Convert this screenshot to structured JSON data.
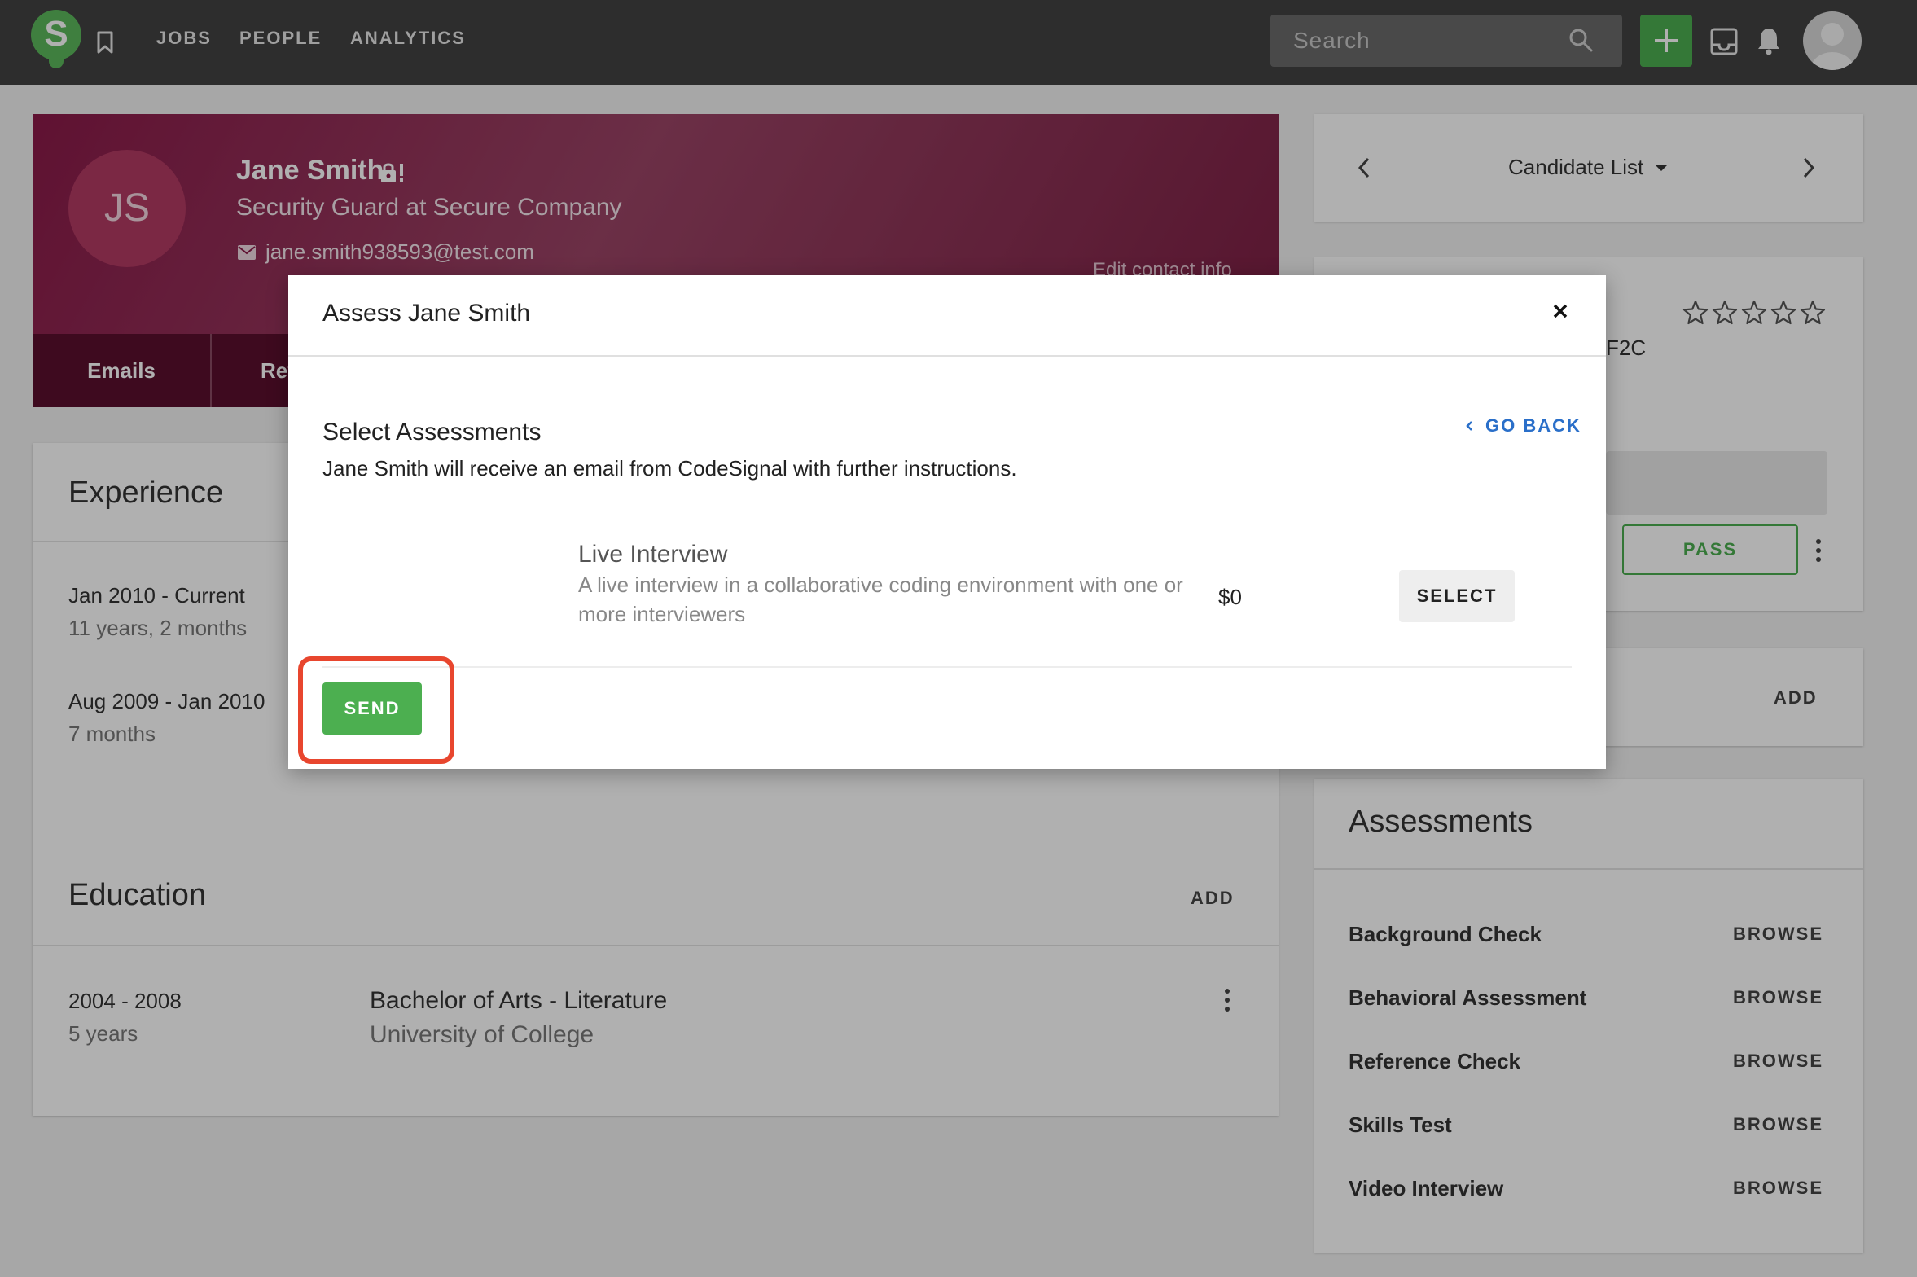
{
  "nav": {
    "logo_letter": "S",
    "links": [
      "JOBS",
      "PEOPLE",
      "ANALYTICS"
    ],
    "search_placeholder": "Search"
  },
  "profile": {
    "initials": "JS",
    "name": "Jane Smith",
    "title": "Security Guard at Secure Company",
    "email": "jane.smith938593@test.com",
    "edit_contact": "Edit contact info",
    "tabs": [
      "Emails",
      "Reviews"
    ]
  },
  "experience": {
    "title": "Experience",
    "items": [
      {
        "dates": "Jan 2010  -  Current",
        "duration": "11 years, 2 months"
      },
      {
        "dates": "Aug 2009  -  Jan 2010",
        "duration": "7 months"
      }
    ]
  },
  "education": {
    "title": "Education",
    "add_label": "ADD",
    "items": [
      {
        "dates": "2004 - 2008",
        "duration": "5 years",
        "degree": "Bachelor of Arts - Literature",
        "school": "University of College"
      }
    ]
  },
  "sidebar": {
    "candidate_list": "Candidate List",
    "code_fragment": "F2C",
    "rating": 0,
    "rating_max": 5,
    "pass_label": "PASS",
    "add_label": "ADD",
    "assessments": {
      "title": "Assessments",
      "browse_label": "BROWSE",
      "items": [
        "Background Check",
        "Behavioral Assessment",
        "Reference Check",
        "Skills Test",
        "Video Interview"
      ]
    }
  },
  "modal": {
    "title": "Assess Jane Smith",
    "go_back": "GO BACK",
    "heading": "Select Assessments",
    "description": "Jane Smith will receive an email from CodeSignal with further instructions.",
    "item": {
      "title": "Live Interview",
      "description": "A live interview in a collaborative coding environment with one or more interviewers",
      "price": "$0",
      "select_label": "SELECT"
    },
    "send_label": "SEND"
  },
  "colors": {
    "brand_green": "#4caf50",
    "profile_maroon": "#8b1a49",
    "link_blue": "#2a6fc9",
    "highlight_red": "#e8462e"
  }
}
